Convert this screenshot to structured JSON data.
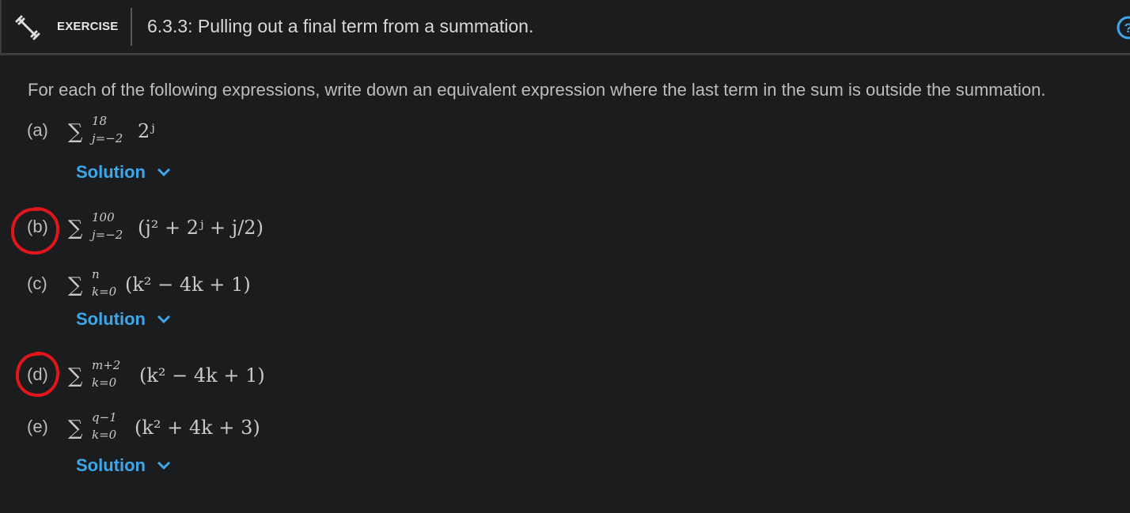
{
  "header": {
    "badge": "EXERCISE",
    "title": "6.3.3: Pulling out a final term from a summation.",
    "icons": {
      "exercise": "dumbbell-icon",
      "help": "help-icon"
    }
  },
  "intro": "For each of the following expressions, write down an equivalent expression where the last term in the sum is outside the summation.",
  "items": [
    {
      "label": "(a)",
      "upper": "18",
      "lower": "j=−2",
      "expr": "2ʲ",
      "has_solution": true
    },
    {
      "label": "(b)",
      "upper": "100",
      "lower": "j=−2",
      "expr": "(j² + 2ʲ + j/2)",
      "has_solution": false,
      "circled": true
    },
    {
      "label": "(c)",
      "upper": "n",
      "lower": "k=0",
      "expr": "(k² − 4k + 1)",
      "has_solution": true
    },
    {
      "label": "(d)",
      "upper": "m+2",
      "lower": "k=0",
      "expr": "(k² − 4k + 1)",
      "has_solution": false,
      "circled": true
    },
    {
      "label": "(e)",
      "upper": "q−1",
      "lower": "k=0",
      "expr": "(k² + 4k + 3)",
      "has_solution": true
    }
  ],
  "solution_label": "Solution",
  "colors": {
    "background": "#1b1c1e",
    "accent": "#3ea7ea",
    "annotation": "#e0161b"
  }
}
